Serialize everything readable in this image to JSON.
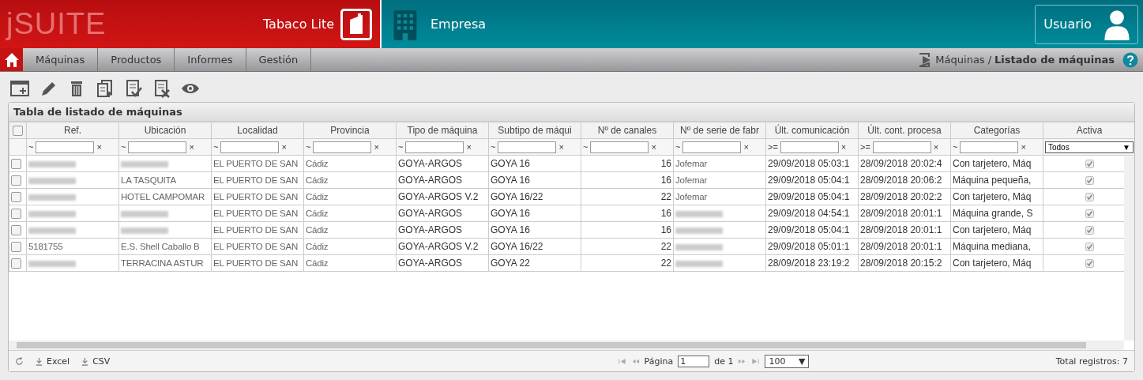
{
  "brand": {
    "logo": "jSUITE",
    "product": "Tabaco Lite",
    "company": "Empresa",
    "user": "Usuario"
  },
  "menu": [
    {
      "label": "Máquinas",
      "selected": false
    },
    {
      "label": "Productos",
      "selected": false
    },
    {
      "label": "Informes",
      "selected": false
    },
    {
      "label": "Gestión",
      "selected": false
    }
  ],
  "breadcrumb": {
    "parent": "Máquinas",
    "separator": "/",
    "current": "Listado de máquinas"
  },
  "toolbar": [
    {
      "kind": "new"
    },
    {
      "kind": "edit"
    },
    {
      "kind": "delete"
    },
    {
      "kind": "copy"
    },
    {
      "kind": "approve"
    },
    {
      "kind": "reject"
    },
    {
      "kind": "view"
    }
  ],
  "table": {
    "title": "Tabla de listado de máquinas",
    "select_all": {
      "checked": false
    },
    "columns": [
      {
        "label": "Ref.",
        "kind": "text",
        "filter": "~",
        "clear": "×"
      },
      {
        "label": "Ubicación",
        "kind": "text",
        "filter": "~",
        "clear": "×"
      },
      {
        "label": "Localidad",
        "kind": "text",
        "filter": "~",
        "clear": "×"
      },
      {
        "label": "Provincia",
        "kind": "text",
        "filter": "~",
        "clear": "×"
      },
      {
        "label": "Tipo de máquina",
        "kind": "text",
        "filter": "~",
        "clear": "×"
      },
      {
        "label": "Subtipo de máqui",
        "kind": "text",
        "filter": "~",
        "clear": "×"
      },
      {
        "label": "Nº de canales",
        "kind": "number",
        "filter": "~",
        "clear": "×"
      },
      {
        "label": "Nº de serie de fabr",
        "kind": "text",
        "filter": "~",
        "clear": "×"
      },
      {
        "label": "Últ. comunicación",
        "kind": "text",
        "filter": ">=",
        "clear": "×"
      },
      {
        "label": "Últ. cont. procesa",
        "kind": "text",
        "filter": ">=",
        "clear": "×"
      },
      {
        "label": "Categorías",
        "kind": "text",
        "filter": "~",
        "clear": "×"
      },
      {
        "label": "Activa",
        "kind": "check",
        "filter_select": "Todos",
        "arrow": "▼"
      }
    ],
    "rows": [
      {
        "selected": false,
        "active": true,
        "cells": [
          null,
          null,
          "EL PUERTO DE SAN",
          "Cádiz",
          "GOYA-ARGOS",
          "GOYA 16",
          "16",
          "Jofemar",
          "29/09/2018 05:03:1",
          "28/09/2018 20:02:4",
          "Con tarjetero, Máq"
        ]
      },
      {
        "selected": false,
        "active": true,
        "cells": [
          null,
          "LA TASQUITA",
          "EL PUERTO DE SAN",
          "Cádiz",
          "GOYA-ARGOS",
          "GOYA 16",
          "16",
          "Jofemar",
          "29/09/2018 05:04:1",
          "28/09/2018 20:06:2",
          "Máquina pequeña,"
        ]
      },
      {
        "selected": false,
        "active": true,
        "cells": [
          null,
          "HOTEL CAMPOMAR",
          "EL PUERTO DE SAN",
          "Cádiz",
          "GOYA-ARGOS V.2",
          "GOYA 16/22",
          "22",
          "Jofemar",
          "29/09/2018 05:04:1",
          "28/09/2018 20:02:2",
          "Con tarjetero, Máq"
        ]
      },
      {
        "selected": false,
        "active": true,
        "cells": [
          null,
          null,
          "EL PUERTO DE SAN",
          "Cádiz",
          "GOYA-ARGOS",
          "GOYA 16",
          "16",
          null,
          "29/09/2018 04:54:1",
          "28/09/2018 20:01:1",
          "Máquina grande, S"
        ]
      },
      {
        "selected": false,
        "active": true,
        "cells": [
          null,
          null,
          "EL PUERTO DE SAN",
          "Cádiz",
          "GOYA-ARGOS",
          "GOYA 16",
          "16",
          null,
          "29/09/2018 05:04:1",
          "28/09/2018 20:01:1",
          "Con tarjetero, Máq"
        ]
      },
      {
        "selected": false,
        "active": true,
        "cells": [
          "5181755",
          "E.S. Shell Caballo B",
          "EL PUERTO DE SAN",
          "Cádiz",
          "GOYA-ARGOS V.2",
          "GOYA 16/22",
          "22",
          null,
          "29/09/2018 05:01:1",
          "28/09/2018 20:01:1",
          "Máquina mediana,"
        ]
      },
      {
        "selected": false,
        "active": true,
        "cells": [
          null,
          "TERRACINA ASTUR",
          "EL PUERTO DE SAN",
          "Cádiz",
          "GOYA-ARGOS",
          "GOYA 22",
          "22",
          null,
          "28/09/2018 23:19:2",
          "28/09/2018 20:15:2",
          "Con tarjetero, Máq"
        ]
      }
    ]
  },
  "footer": {
    "exports": [
      "Excel",
      "CSV"
    ],
    "page_label": "Página",
    "page": "1",
    "of": "de 1",
    "page_size": "100",
    "page_size_arrow": "▼",
    "total": "Total registros: 7"
  }
}
